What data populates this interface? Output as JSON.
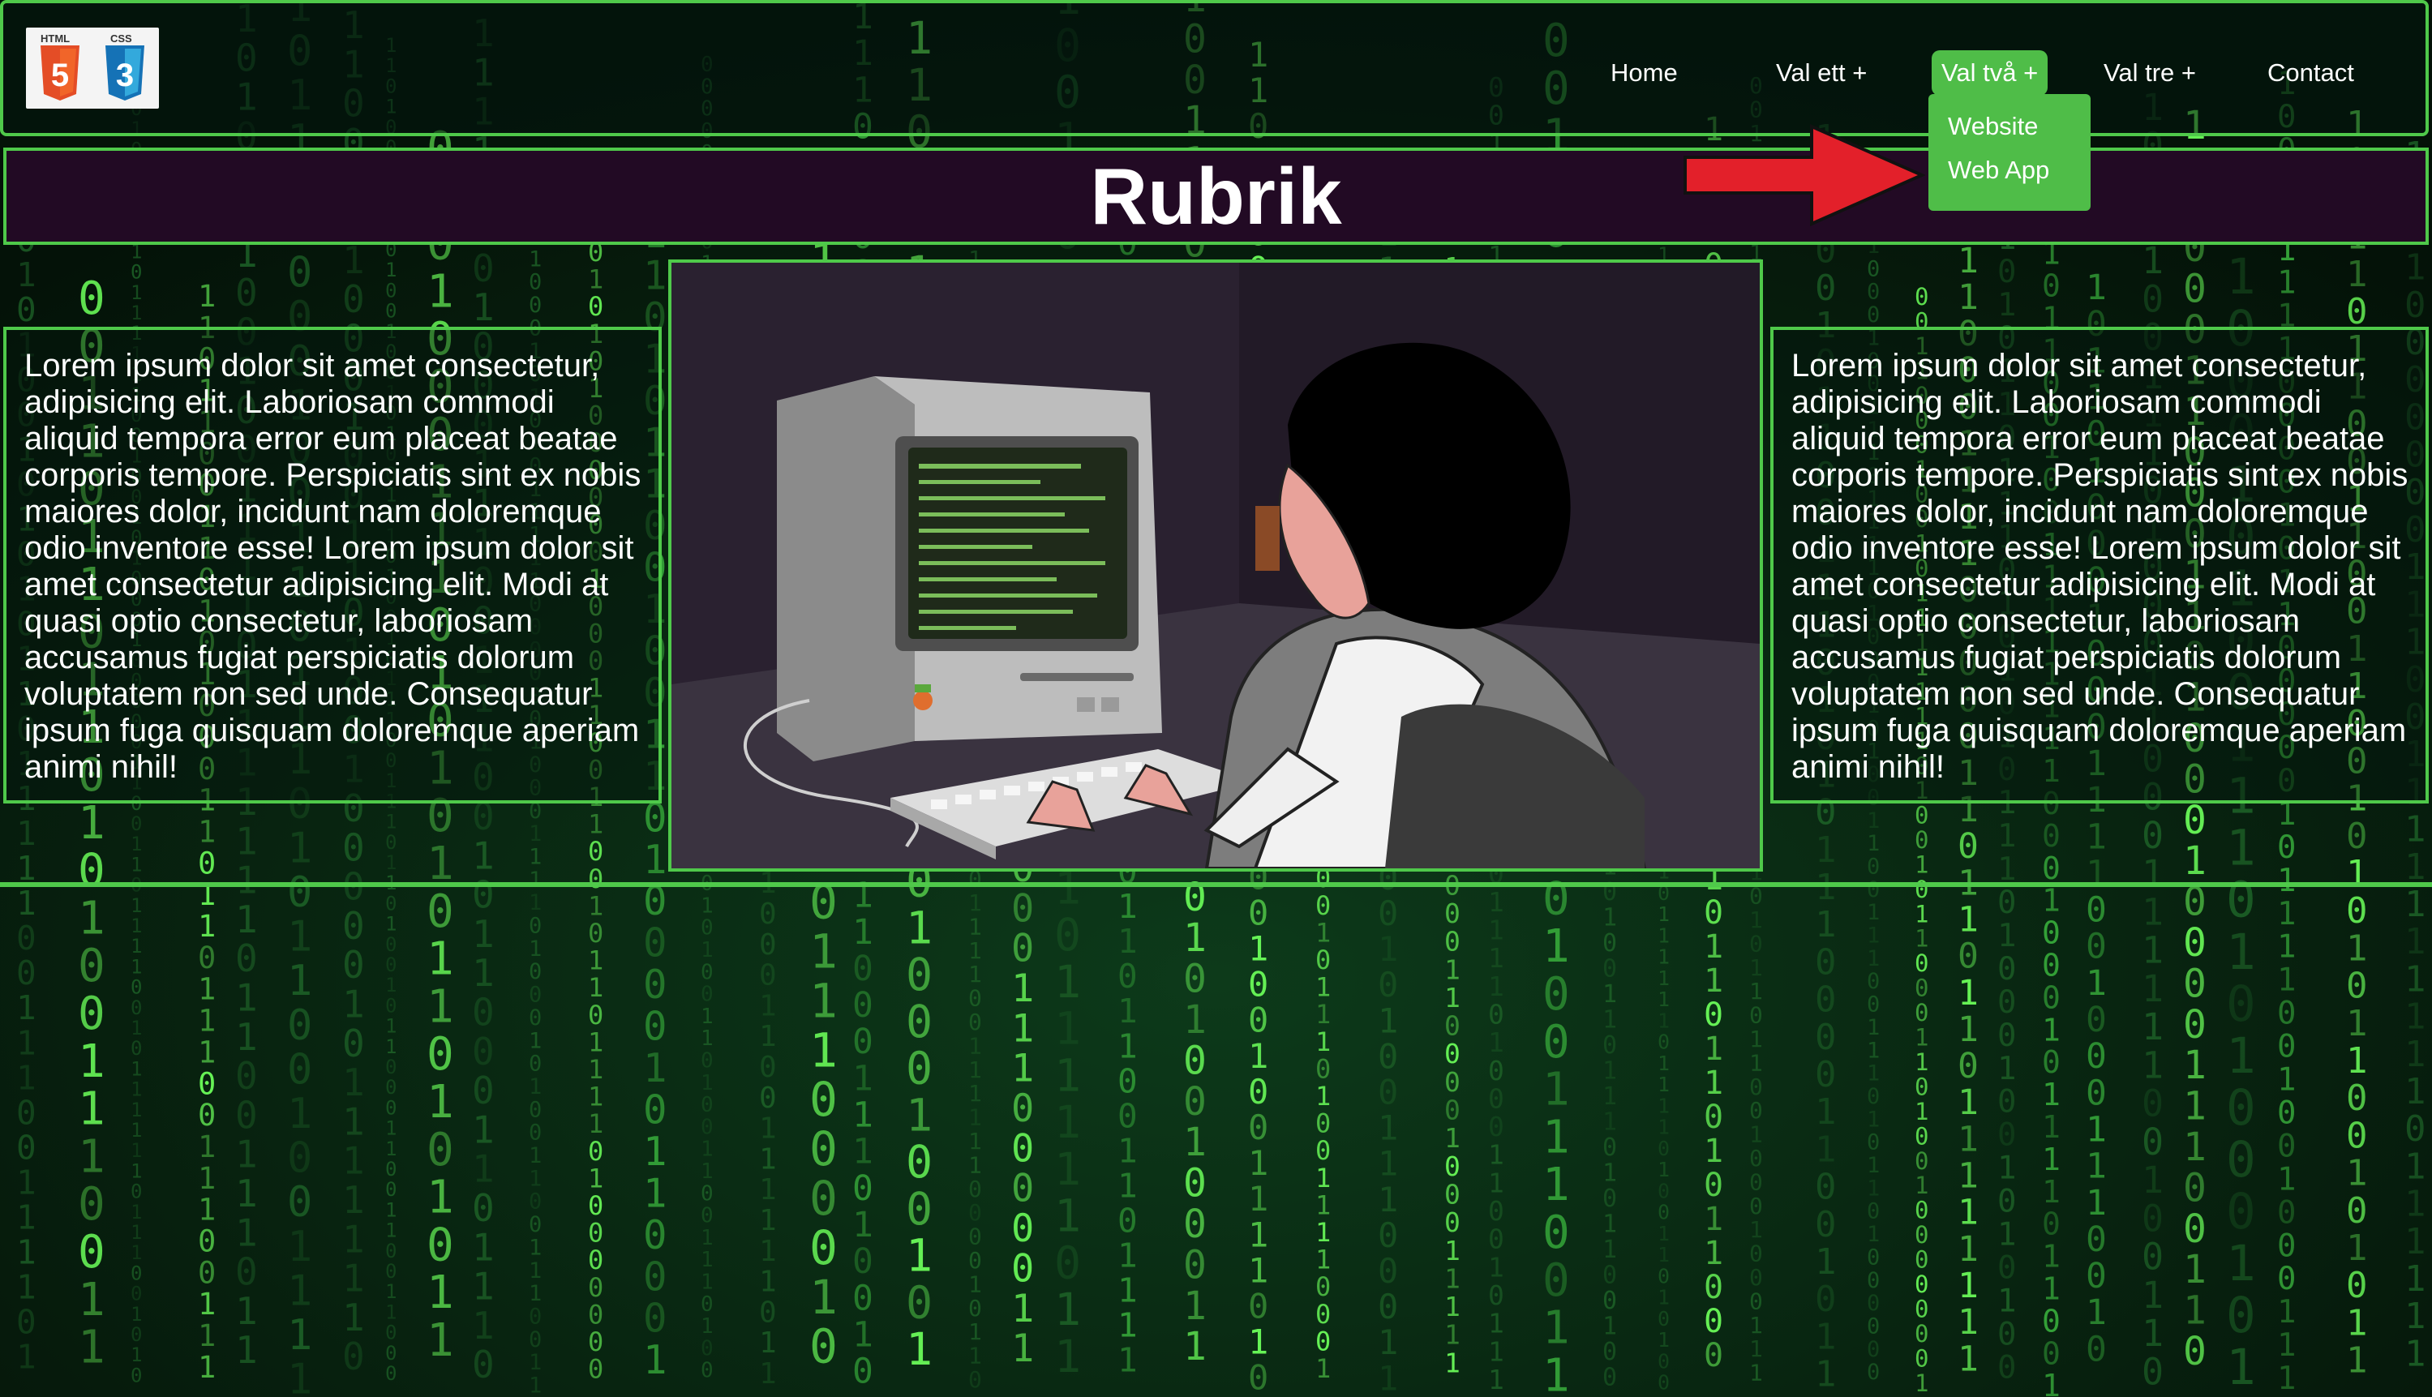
{
  "logo": {
    "html_label": "HTML",
    "css_label": "CSS",
    "html_number": "5",
    "css_number": "3"
  },
  "nav": {
    "items": [
      {
        "label": "Home"
      },
      {
        "label": "Val ett +"
      },
      {
        "label": "Val två +"
      },
      {
        "label": "Val tre +"
      },
      {
        "label": "Contact"
      }
    ],
    "active_index": 2,
    "dropdown": [
      "Website",
      "Web App"
    ]
  },
  "title": "Rubrik",
  "body_text": "Lorem ipsum dolor sit amet consectetur, adipisicing elit. Laboriosam commodi aliquid tempora error eum placeat beatae corporis tempore. Perspiciatis sint ex nobis maiores dolor, incidunt nam doloremque odio inventore esse! Lorem ipsum dolor sit amet consectetur adipisicing elit. Modi at quasi optio consectetur, laboriosam accusamus fugiat perspiciatis dolorum voluptatem non sed unde. Consequatur ipsum fuga quisquam doloremque aperiam animi nihil!",
  "colors": {
    "accent_green": "#4fc94a",
    "dropdown_green": "#4fbd48",
    "title_bar_bg": "#220a24",
    "arrow_red": "#e3202a"
  },
  "icons": [
    "html5-logo-icon",
    "css3-logo-icon",
    "red-arrow-icon"
  ]
}
